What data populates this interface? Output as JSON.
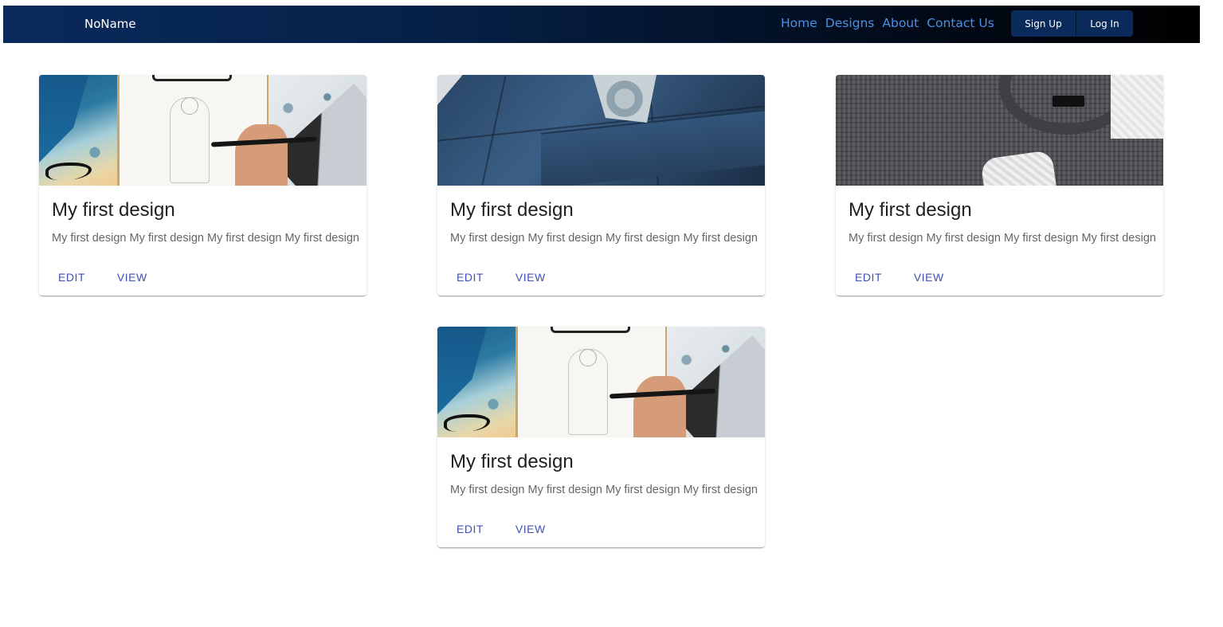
{
  "navbar": {
    "brand": "NoName",
    "links": [
      "Home",
      "Designs",
      "About",
      "Contact Us"
    ],
    "signup_label": "Sign Up",
    "login_label": "Log In"
  },
  "cards": [
    {
      "image": "sketch-image",
      "title": "My first design",
      "description": "My first design My first design My first design My first design",
      "edit_label": "EDIT",
      "view_label": "VIEW"
    },
    {
      "image": "suit-image",
      "title": "My first design",
      "description": "My first design My first design My first design My first design",
      "edit_label": "EDIT",
      "view_label": "VIEW"
    },
    {
      "image": "sweater-image",
      "title": "My first design",
      "description": "My first design My first design My first design My first design",
      "edit_label": "EDIT",
      "view_label": "VIEW"
    },
    {
      "image": "sketch-image",
      "title": "My first design",
      "description": "My first design My first design My first design My first design",
      "edit_label": "EDIT",
      "view_label": "VIEW"
    }
  ],
  "colors": {
    "navbar_start": "#0a2a5c",
    "navbar_end": "#000000",
    "nav_link": "#4c8fe6",
    "action_button": "#3f51b5"
  }
}
